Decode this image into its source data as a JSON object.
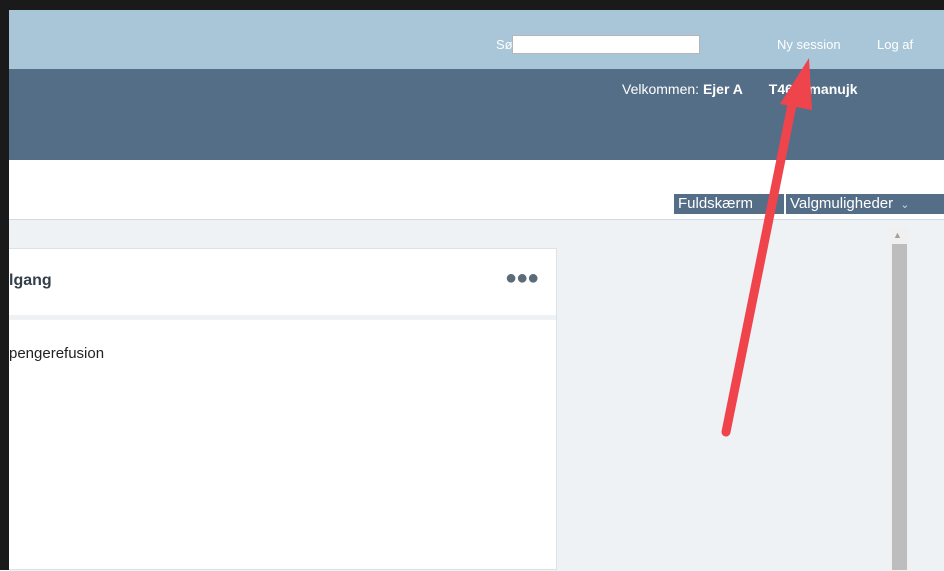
{
  "search": {
    "label": "Søg:",
    "value": ""
  },
  "topnav": {
    "new_session": "Ny session",
    "logout": "Log af"
  },
  "header": {
    "welcome_prefix": "Velkommen:",
    "user_name_part": "Ejer A",
    "user_code": "T4691manujk"
  },
  "toolbar": {
    "fullscreen": "Fuldskærm",
    "options": "Valgmuligheder"
  },
  "widget": {
    "title": "lgang",
    "menu_icon": "more-horizontal-icon",
    "items": [
      "pengerefusion"
    ]
  },
  "annotation": {
    "color": "#f0444c"
  }
}
